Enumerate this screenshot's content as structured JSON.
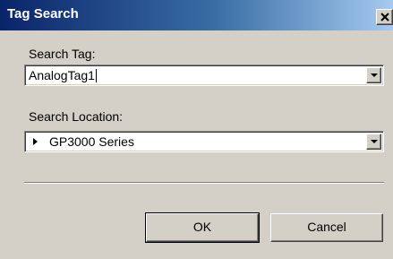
{
  "window": {
    "title": "Tag Search",
    "close_glyph": "X"
  },
  "search_tag": {
    "label": "Search Tag:",
    "value": "AnalogTag1"
  },
  "search_location": {
    "label": "Search Location:",
    "value": "GP3000 Series"
  },
  "buttons": {
    "ok": "OK",
    "cancel": "Cancel"
  },
  "icons": [
    "close-icon",
    "dropdown-arrow-icon",
    "tree-expand-icon"
  ],
  "colors": {
    "title_gradient_start": "#0a246a",
    "title_gradient_end": "#a6caf0",
    "face": "#d4d0c8"
  }
}
